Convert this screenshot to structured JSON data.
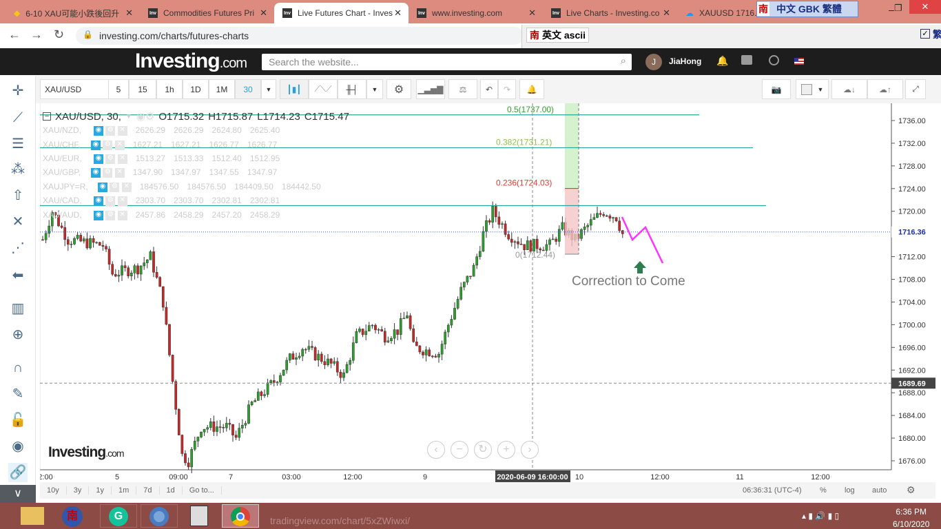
{
  "browser": {
    "tabs": [
      {
        "title": "6-10 XAU可能小跌後回升",
        "icon": "diamond-icon"
      },
      {
        "title": "Commodities Futures Pri",
        "icon": "investing-favicon"
      },
      {
        "title": "Live Futures Chart - Inves",
        "icon": "investing-favicon"
      },
      {
        "title": "www.investing.com",
        "icon": "investing-favicon"
      },
      {
        "title": "Live Charts - Investing.co",
        "icon": "investing-favicon"
      },
      {
        "title": "XAUUSD 1716.",
        "icon": "tradingview-favicon"
      }
    ],
    "url": "investing.com/charts/futures-charts",
    "ime_top": {
      "logo": "南",
      "label": "中文 GBK 繁體"
    },
    "ime_bar": {
      "logo": "南",
      "label": "英文 ascii",
      "right": "繁"
    }
  },
  "site": {
    "logo": "Investing",
    "logo_suffix": ".com",
    "search_placeholder": "Search the website...",
    "user_initial": "J",
    "user_name": "JiaHong"
  },
  "toolbar": {
    "symbol": "XAU/USD",
    "intervals": [
      "5",
      "15",
      "1h",
      "1D",
      "1M",
      "30"
    ],
    "active_interval": "30"
  },
  "legend": {
    "main": {
      "symbol": "XAU/USD, 30,",
      "o": "O1715.32",
      "h": "H1715.87",
      "l": "L1714.23",
      "c": "C1715.47"
    },
    "compare": [
      {
        "symbol": "XAU/NZD,",
        "values": [
          "2626.29",
          "2626.29",
          "2624.80",
          "2625.40"
        ]
      },
      {
        "symbol": "XAU/CHF,",
        "values": [
          "1627.21",
          "1627.21",
          "1626.77",
          "1626.77"
        ]
      },
      {
        "symbol": "XAU/EUR,",
        "values": [
          "1513.27",
          "1513.33",
          "1512.40",
          "1512.95"
        ]
      },
      {
        "symbol": "XAU/GBP,",
        "values": [
          "1347.90",
          "1347.97",
          "1347.55",
          "1347.97"
        ]
      },
      {
        "symbol": "XAUJPY=R,",
        "values": [
          "184576.50",
          "184576.50",
          "184409.50",
          "184442.50"
        ]
      },
      {
        "symbol": "XAU/CAD,",
        "values": [
          "2303.70",
          "2303.70",
          "2302.81",
          "2302.81"
        ]
      },
      {
        "symbol": "XAU/AUD,",
        "values": [
          "2457.86",
          "2458.29",
          "2457.20",
          "2458.29"
        ]
      }
    ]
  },
  "chart_data": {
    "type": "candlestick",
    "ylim": [
      1674,
      1738
    ],
    "y_ticks": [
      "1736.00",
      "1732.00",
      "1728.00",
      "1724.00",
      "1720.00",
      "1716.00",
      "1712.00",
      "1708.00",
      "1704.00",
      "1700.00",
      "1696.00",
      "1692.00",
      "1688.00",
      "1684.00",
      "1680.00",
      "1676.00"
    ],
    "x_ticks": [
      "2:00",
      "5",
      "09:00",
      "7",
      "03:00",
      "12:00",
      "9",
      "10",
      "12:00",
      "11",
      "12:00"
    ],
    "crosshair_time": "2020-06-09 16:00:00",
    "last_price": "1716.36",
    "crosshair_price": "1689.69",
    "key_closes": [
      [
        0,
        1715
      ],
      [
        3,
        1720
      ],
      [
        8,
        1715
      ],
      [
        19,
        1714
      ],
      [
        22,
        1709
      ],
      [
        30,
        1710
      ],
      [
        34,
        1712
      ],
      [
        38,
        1704
      ],
      [
        41,
        1690
      ],
      [
        44,
        1677
      ],
      [
        46,
        1676
      ],
      [
        50,
        1682
      ],
      [
        58,
        1682
      ],
      [
        61,
        1680
      ],
      [
        66,
        1686
      ],
      [
        73,
        1690
      ],
      [
        78,
        1694
      ],
      [
        82,
        1696
      ],
      [
        91,
        1693
      ],
      [
        95,
        1691
      ],
      [
        99,
        1698
      ],
      [
        104,
        1700
      ],
      [
        108,
        1698
      ],
      [
        112,
        1699
      ],
      [
        115,
        1702
      ],
      [
        117,
        1696
      ],
      [
        125,
        1695
      ],
      [
        128,
        1700
      ],
      [
        132,
        1706
      ],
      [
        136,
        1710
      ],
      [
        139,
        1716
      ],
      [
        142,
        1720
      ],
      [
        147,
        1716
      ],
      [
        152,
        1714
      ],
      [
        160,
        1714
      ],
      [
        164,
        1717
      ],
      [
        168,
        1715
      ],
      [
        173,
        1718
      ],
      [
        177,
        1720
      ],
      [
        181,
        1719
      ],
      [
        183,
        1716
      ]
    ],
    "fib_levels": [
      {
        "label": "0.5(1737.00)",
        "price": 1737.0
      },
      {
        "label": "0.382(1731.21)",
        "price": 1731.21
      },
      {
        "label": "0.236(1724.03)",
        "price": 1724.03
      },
      {
        "label": "0(1712.44)",
        "price": 1712.44
      }
    ],
    "resistance_price": 1721,
    "annotation": "Correction to Come",
    "colors": {
      "up": "#2ca02c",
      "down": "#c62828",
      "fib": "#26a69a",
      "projection": "#ff33ff",
      "arrow": "#2e7d4f"
    }
  },
  "watermark": {
    "logo": "Investing",
    "suffix": ".com"
  },
  "bottom": {
    "ranges": [
      "10y",
      "3y",
      "1y",
      "1m",
      "7d",
      "1d",
      "Go to..."
    ],
    "clock": "06:36:31 (UTC-4)",
    "pct": "%",
    "log": "log",
    "auto": "auto"
  },
  "taskbar": {
    "time": "6:36 PM",
    "date": "6/10/2020",
    "bg_url": "tradingview.com/chart/5xZWiwxi/"
  }
}
